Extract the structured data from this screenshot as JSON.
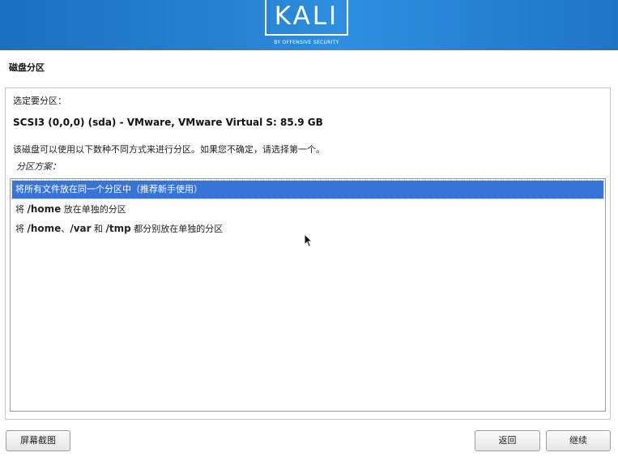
{
  "banner": {
    "logo_text": "KALI",
    "logo_subtitle": "BY OFFENSIVE SECURITY"
  },
  "page": {
    "title": "磁盘分区"
  },
  "main": {
    "select_label": "选定要分区：",
    "disk_name": "SCSI3 (0,0,0) (sda) - VMware, VMware Virtual S: 85.9 GB",
    "description": "该磁盘可以使用以下数种不同方式来进行分区。如果您不确定，请选择第一个。",
    "scheme_label": "分区方案：",
    "options": [
      {
        "text": "将所有文件放在同一个分区中（推荐新手使用）",
        "selected": true
      },
      {
        "pre": "将 ",
        "b1": "/home",
        "post": " 放在单独的分区",
        "selected": false
      },
      {
        "pre": "将 ",
        "b1": "/home",
        "mid1": "、",
        "b2": "/var",
        "mid2": " 和 ",
        "b3": "/tmp",
        "post": " 都分别放在单独的分区",
        "selected": false
      }
    ]
  },
  "buttons": {
    "screenshot": "屏幕截图",
    "back": "返回",
    "continue": "继续"
  },
  "colors": {
    "banner_blue": "#2a86d6",
    "selection_blue": "#3874d8"
  },
  "icons": {
    "cursor": "mouse-pointer-icon"
  }
}
